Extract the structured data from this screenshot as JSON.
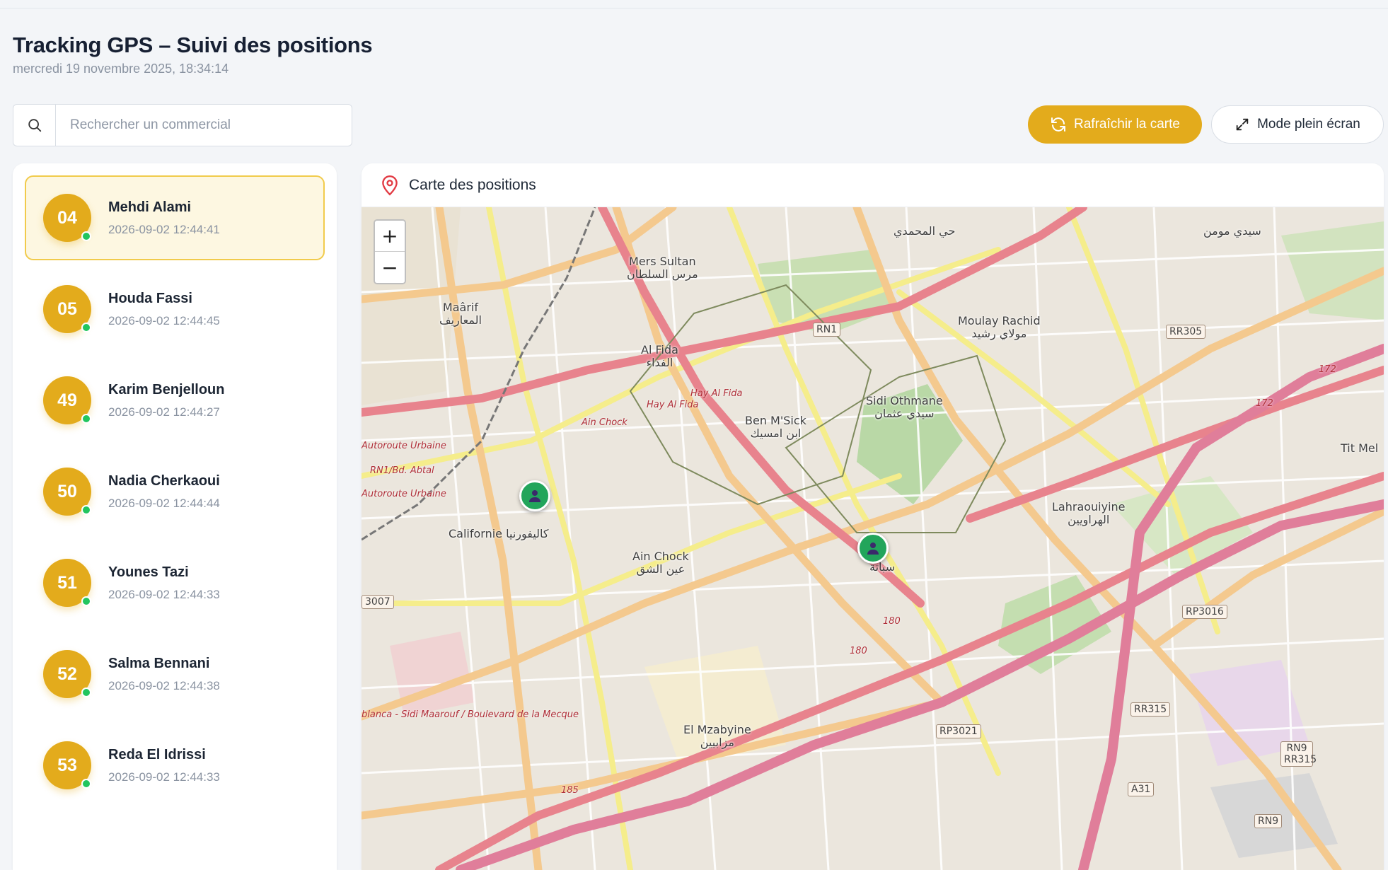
{
  "header": {
    "title": "Tracking GPS – Suivi des positions",
    "datetime": "mercredi 19 novembre 2025, 18:34:14"
  },
  "search": {
    "icon": "search-icon",
    "placeholder": "Rechercher un commercial",
    "value": ""
  },
  "toolbar": {
    "refresh_label": "Rafraîchir la carte",
    "refresh_icon": "refresh-icon",
    "fullscreen_label": "Mode plein écran",
    "fullscreen_icon": "expand-icon"
  },
  "colors": {
    "accent": "#e3ab1c",
    "online": "#22c55e",
    "marker": "#22a55b",
    "active_card_bg": "#fdf7e1",
    "active_card_border": "#f1cb4c"
  },
  "commercials": [
    {
      "code": "04",
      "name": "Mehdi Alami",
      "last_seen": "2026-09-02 12:44:41",
      "active": true,
      "online": true
    },
    {
      "code": "05",
      "name": "Houda Fassi",
      "last_seen": "2026-09-02 12:44:45",
      "active": false,
      "online": true
    },
    {
      "code": "49",
      "name": "Karim Benjelloun",
      "last_seen": "2026-09-02 12:44:27",
      "active": false,
      "online": true
    },
    {
      "code": "50",
      "name": "Nadia Cherkaoui",
      "last_seen": "2026-09-02 12:44:44",
      "active": false,
      "online": true
    },
    {
      "code": "51",
      "name": "Younes Tazi",
      "last_seen": "2026-09-02 12:44:33",
      "active": false,
      "online": true
    },
    {
      "code": "52",
      "name": "Salma Bennani",
      "last_seen": "2026-09-02 12:44:38",
      "active": false,
      "online": true
    },
    {
      "code": "53",
      "name": "Reda El Idrissi",
      "last_seen": "2026-09-02 12:44:33",
      "active": false,
      "online": true
    }
  ],
  "map": {
    "title": "Carte des positions",
    "title_icon": "map-pin-icon",
    "zoom_in": "+",
    "zoom_out": "−",
    "places": {
      "mers_sultan": "Mers Sultan",
      "mers_sultan_ar": "مرس السلطان",
      "maarif": "Maârif",
      "maarif_ar": "المعاريف",
      "al_fida": "Al Fida",
      "al_fida_ar": "الفداء",
      "moulay_rachid": "Moulay Rachid",
      "moulay_rachid_ar": "مولاي رشيد",
      "ben_msick": "Ben M'Sick",
      "ben_msick_ar": "ابن امسيك",
      "sidi_othmane": "Sidi Othmane",
      "sidi_othmane_ar": "سيدي عثمان",
      "californie": "Californie",
      "californie_ar": "كاليفورنيا",
      "ain_chock": "Ain Chock",
      "ain_chock_ar": "عين الشق",
      "sbata_ar": "سباتة",
      "lahraouiyine": "Lahraouiyine",
      "lahraouiyine_ar": "الهراويين",
      "el_mzabyine": "El Mzabyine",
      "el_mzabyine_ar": "مزابيين",
      "hay_mohammadi_ar": "حي المحمدي",
      "sidi_moumen_ar": "سيدي مومن",
      "tit_mellil": "Tit Mel"
    },
    "roads": {
      "hay_al_fida": "Hay Al Fida",
      "ain_chock_road": "Ain Chock",
      "autoroute_urbaine": "Autoroute Urbaine",
      "rn1_abtal": "RN1/Bd. Abtal",
      "sidi_maarouf": "blanca - Sidi Maarouf / Boulevard de la Mecque",
      "r180": "180",
      "r172": "172",
      "r185": "185"
    },
    "shields": [
      "RN1",
      "RR305",
      "3007",
      "RP3016",
      "RR315",
      "RP3021",
      "A31",
      "RN9",
      "RN9 RR315"
    ],
    "markers": [
      {
        "name": "person-marker-icon"
      },
      {
        "name": "person-marker-icon"
      }
    ]
  }
}
